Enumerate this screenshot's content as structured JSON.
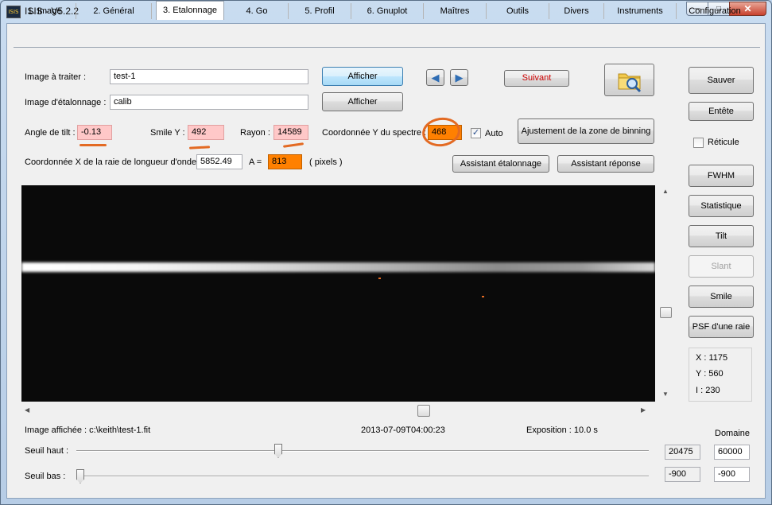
{
  "window": {
    "title": "ISIS - V5.2.2",
    "icon": "ISIS"
  },
  "titlebar": {
    "minimize": "─",
    "maximize": "□",
    "close": "✕"
  },
  "tabs": [
    "1. Image",
    "2. Général",
    "3. Etalonnage",
    "4. Go",
    "5. Profil",
    "6. Gnuplot",
    "Maîtres",
    "Outils",
    "Divers",
    "Instruments",
    "Configuration"
  ],
  "form": {
    "image_label": "Image à traiter :",
    "image_value": "test-1",
    "calib_label": "Image d'étalonnage :",
    "calib_value": "calib",
    "show_label": "Afficher",
    "next_label": "Suivant",
    "tilt_label": "Angle de tilt :",
    "tilt_value": "-0.13",
    "smile_label": "Smile Y :",
    "smile_value": "492",
    "radius_label": "Rayon :",
    "radius_value": "14589",
    "coordy_label": "Coordonnée Y du spectre :",
    "coordy_value": "468",
    "auto_label": "Auto",
    "auto_check": "✓",
    "binning_label": "Ajustement de la zone de binning",
    "coordx_label": "Coordonnée X de la raie de longueur d'onde",
    "coordx_value": "5852.49",
    "a_label": "A  =",
    "a_value": "813",
    "pixels_label": "( pixels )",
    "assist_calib": "Assistant étalonnage",
    "assist_resp": "Assistant réponse"
  },
  "nav": {
    "prev": "◀",
    "next": "▶"
  },
  "sidebar": {
    "save": "Sauver",
    "header": "Entête",
    "reticle": "Réticule",
    "fwhm": "FWHM",
    "stats": "Statistique",
    "tilt": "Tilt",
    "slant": "Slant",
    "smile": "Smile",
    "psf": "PSF d'une raie"
  },
  "info": {
    "x": "X : 1175",
    "y": "Y : 560",
    "i": "I  : 230"
  },
  "status": {
    "image_shown": "Image affichée : c:\\keith\\test-1.fit",
    "date": "2013-07-09T04:00:23",
    "exposure": "Exposition : 10.0 s",
    "domain_label": "Domaine"
  },
  "thresholds": {
    "high_label": "Seuil haut :",
    "high_value": "20475",
    "high_domain": "60000",
    "low_label": "Seuil bas :",
    "low_value": "-900",
    "low_domain": "-900"
  },
  "scroll": {
    "up": "▲",
    "down": "▼",
    "left": "◀",
    "right": "▶"
  },
  "colors": {
    "accent_orange": "#ff8000",
    "pink_field": "#ffc8c8",
    "annotation": "#e36a23",
    "next_text": "#cc0000"
  }
}
